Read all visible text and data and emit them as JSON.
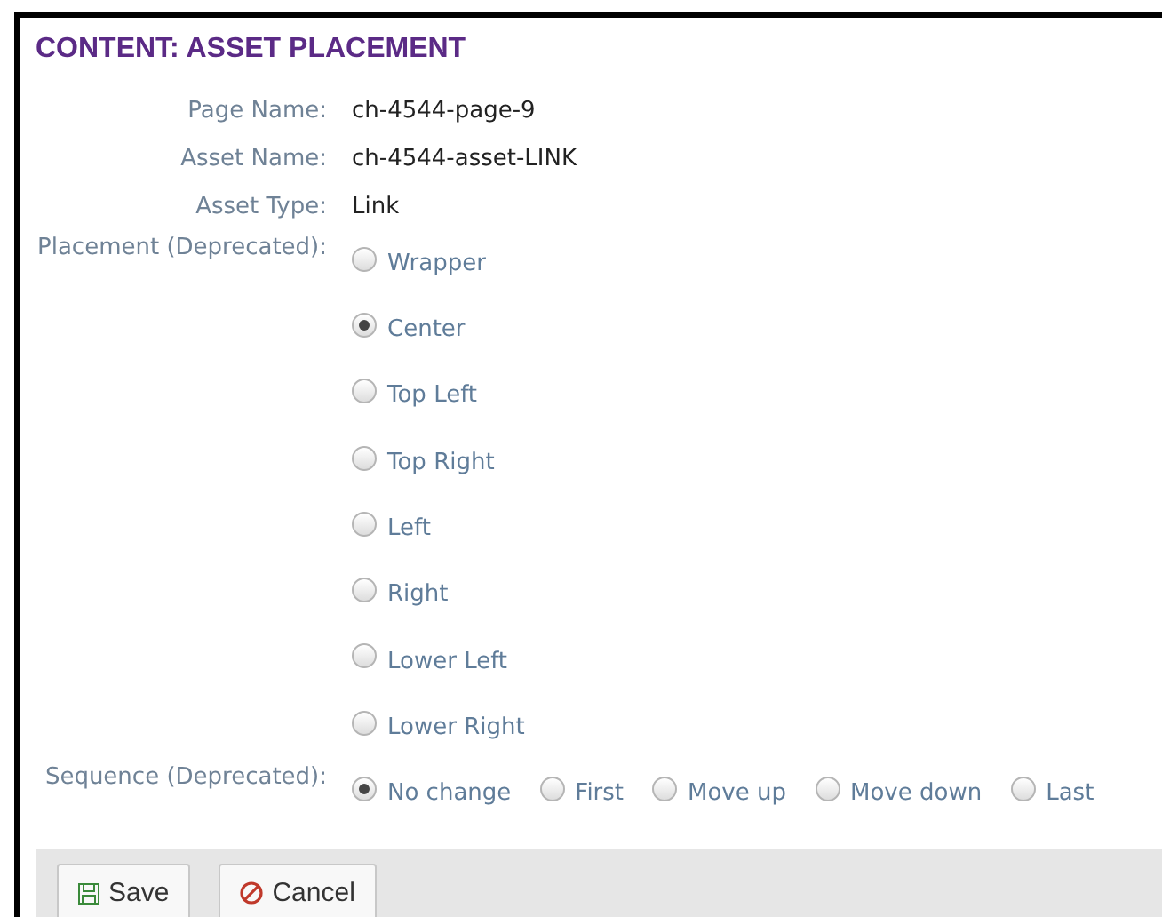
{
  "title": "CONTENT: ASSET PLACEMENT",
  "fields": [
    {
      "label": "Page Name:",
      "value": "ch-4544-page-9"
    },
    {
      "label": "Asset Name:",
      "value": "ch-4544-asset-LINK"
    },
    {
      "label": "Asset Type:",
      "value": "Link"
    }
  ],
  "placement": {
    "label": "Placement (Deprecated):",
    "options": [
      {
        "label": "Wrapper",
        "selected": false
      },
      {
        "label": "Center",
        "selected": true
      },
      {
        "label": "Top Left",
        "selected": false
      },
      {
        "label": "Top Right",
        "selected": false
      },
      {
        "label": "Left",
        "selected": false
      },
      {
        "label": "Right",
        "selected": false
      },
      {
        "label": "Lower Left",
        "selected": false
      },
      {
        "label": "Lower Right",
        "selected": false
      }
    ]
  },
  "sequence": {
    "label": "Sequence (Deprecated):",
    "options": [
      {
        "label": "No change",
        "selected": true
      },
      {
        "label": "First",
        "selected": false
      },
      {
        "label": "Move up",
        "selected": false
      },
      {
        "label": "Move down",
        "selected": false
      },
      {
        "label": "Last",
        "selected": false
      }
    ]
  },
  "buttons": [
    {
      "kind": "save",
      "label": "Save"
    },
    {
      "kind": "cancel",
      "label": "Cancel"
    }
  ]
}
